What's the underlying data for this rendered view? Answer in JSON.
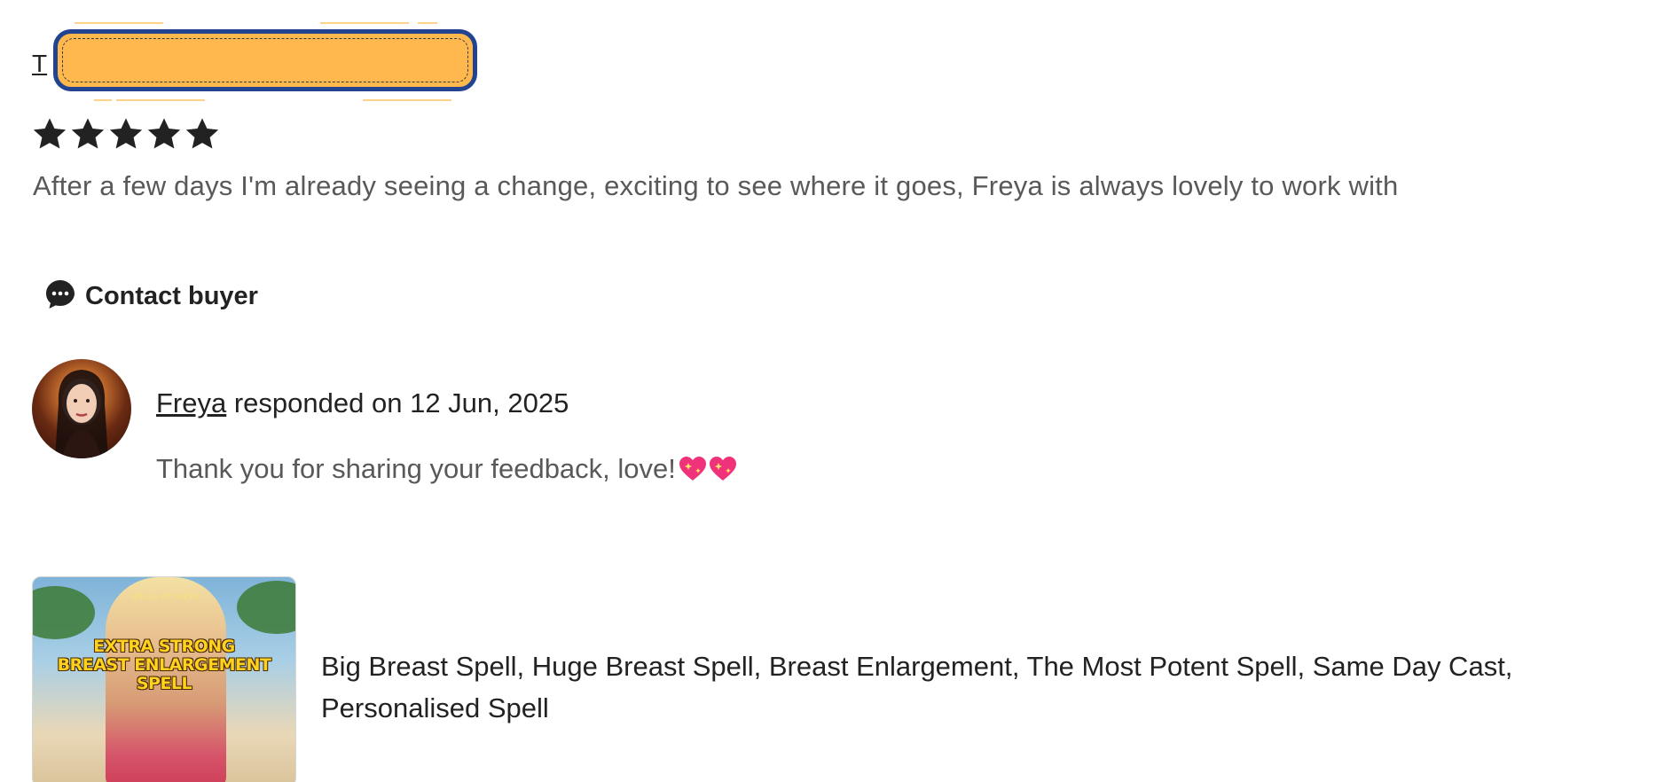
{
  "review": {
    "reviewer_name_visible": "T",
    "rating": 5,
    "rating_max": 5,
    "text": "After a few days I'm already seeing a change, exciting to see where it goes, Freya is always lovely to work with"
  },
  "actions": {
    "contact_buyer_label": "Contact buyer"
  },
  "response": {
    "seller_name": "Freya",
    "date_text": " responded on 12 Jun, 2025",
    "text": "Thank you for sharing your feedback, love!"
  },
  "listing": {
    "thumb_watermark": "SPELLS BY FREYA",
    "thumb_caption_line1": "EXTRA STRONG",
    "thumb_caption_line2": "BREAST ENLARGEMENT",
    "thumb_caption_line3": "SPELL",
    "title": "Big Breast Spell, Huge Breast Spell, Breast Enlargement, The Most Potent Spell, Same Day Cast, Personalised Spell"
  },
  "colors": {
    "star": "#222222",
    "redaction_fill": "#ffb84d",
    "redaction_border": "#22438f",
    "muted_text": "#595959",
    "heart": "#f0327a"
  },
  "icons": {
    "contact": "chat-bubble-icon",
    "star": "star-icon",
    "heart": "sparkling-heart-icon"
  }
}
